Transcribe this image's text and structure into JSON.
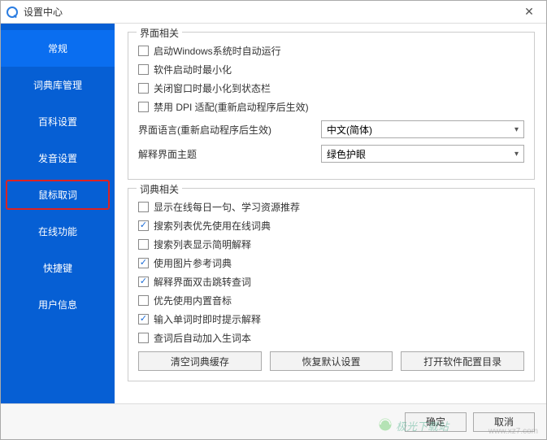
{
  "window": {
    "title": "设置中心"
  },
  "sidebar": {
    "items": [
      {
        "label": "常规",
        "active": true
      },
      {
        "label": "词典库管理"
      },
      {
        "label": "百科设置"
      },
      {
        "label": "发音设置"
      },
      {
        "label": "鼠标取词",
        "highlight": true
      },
      {
        "label": "在线功能"
      },
      {
        "label": "快捷键"
      },
      {
        "label": "用户信息"
      }
    ]
  },
  "group_ui": {
    "title": "界面相关",
    "checks": [
      {
        "label": "启动Windows系统时自动运行",
        "checked": false
      },
      {
        "label": "软件启动时最小化",
        "checked": false
      },
      {
        "label": "关闭窗口时最小化到状态栏",
        "checked": false
      },
      {
        "label": "禁用 DPI 适配(重新启动程序后生效)",
        "checked": false
      }
    ],
    "lang_label": "界面语言(重新启动程序后生效)",
    "lang_value": "中文(简体)",
    "theme_label": "解释界面主题",
    "theme_value": "绿色护眼"
  },
  "group_dict": {
    "title": "词典相关",
    "checks": [
      {
        "label": "显示在线每日一句、学习资源推荐",
        "checked": false
      },
      {
        "label": "搜索列表优先使用在线词典",
        "checked": true
      },
      {
        "label": "搜索列表显示简明解释",
        "checked": false
      },
      {
        "label": "使用图片参考词典",
        "checked": true
      },
      {
        "label": "解释界面双击跳转查词",
        "checked": true
      },
      {
        "label": "优先使用内置音标",
        "checked": false
      },
      {
        "label": "输入单词时即时提示解释",
        "checked": true
      },
      {
        "label": "查词后自动加入生词本",
        "checked": false
      }
    ],
    "buttons": {
      "clear": "清空词典缓存",
      "restore": "恢复默认设置",
      "open": "打开软件配置目录"
    }
  },
  "footer": {
    "ok": "确定",
    "cancel": "取消"
  },
  "watermark": {
    "text": "极光下载站",
    "url": "www.xz7.com"
  }
}
